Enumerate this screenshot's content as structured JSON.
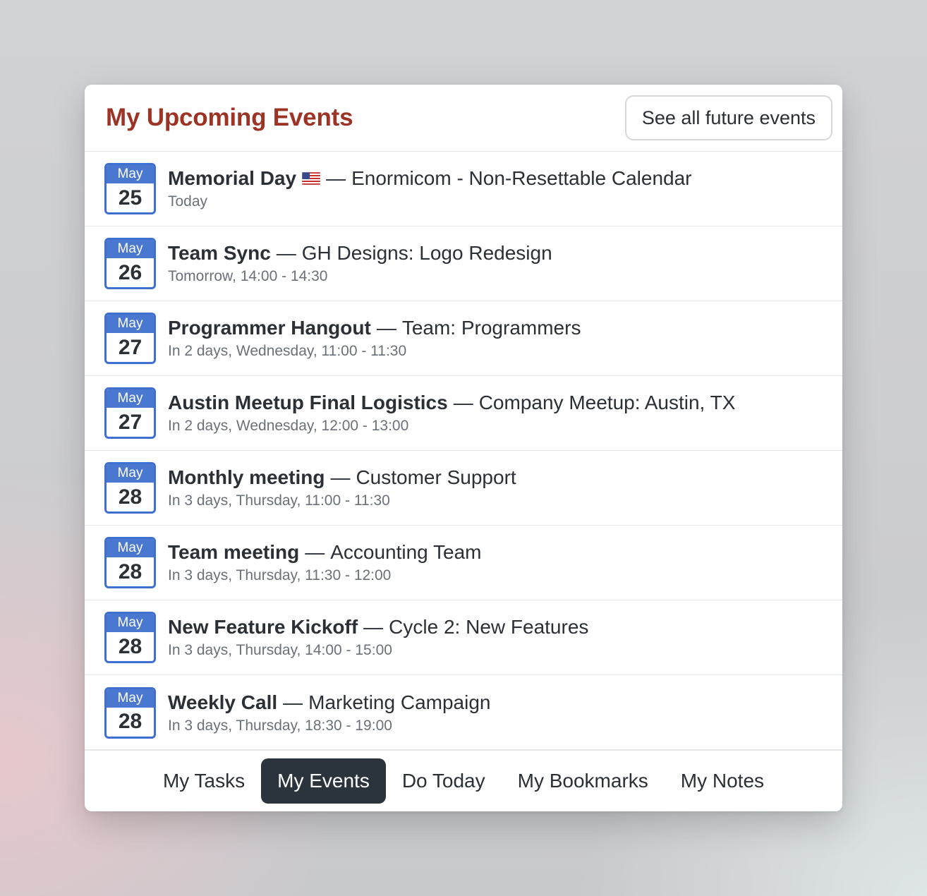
{
  "header": {
    "title": "My Upcoming Events",
    "see_all_label": "See all future events"
  },
  "events": [
    {
      "month": "May",
      "day": "25",
      "name": "Memorial Day",
      "separator": "—",
      "context": "Enormicom - Non-Resettable Calendar",
      "time": "Today",
      "icon": "us-flag-icon"
    },
    {
      "month": "May",
      "day": "26",
      "name": "Team Sync",
      "separator": "—",
      "context": "GH Designs: Logo Redesign",
      "time": "Tomorrow, 14:00 - 14:30"
    },
    {
      "month": "May",
      "day": "27",
      "name": "Programmer Hangout",
      "separator": "—",
      "context": "Team: Programmers",
      "time": "In 2 days, Wednesday, 11:00 - 11:30"
    },
    {
      "month": "May",
      "day": "27",
      "name": "Austin Meetup Final Logistics",
      "separator": "—",
      "context": "Company Meetup: Austin, TX",
      "time": "In 2 days, Wednesday, 12:00 - 13:00"
    },
    {
      "month": "May",
      "day": "28",
      "name": "Monthly meeting",
      "separator": "—",
      "context": "Customer Support",
      "time": "In 3 days, Thursday, 11:00 - 11:30"
    },
    {
      "month": "May",
      "day": "28",
      "name": "Team meeting",
      "separator": "—",
      "context": "Accounting Team",
      "time": "In 3 days, Thursday, 11:30 - 12:00"
    },
    {
      "month": "May",
      "day": "28",
      "name": "New Feature Kickoff",
      "separator": "—",
      "context": "Cycle 2: New Features",
      "time": "In 3 days, Thursday, 14:00 - 15:00"
    },
    {
      "month": "May",
      "day": "28",
      "name": "Weekly Call",
      "separator": "—",
      "context": "Marketing Campaign",
      "time": "In 3 days, Thursday, 18:30 - 19:00"
    }
  ],
  "tabs": [
    {
      "label": "My Tasks",
      "active": false
    },
    {
      "label": "My Events",
      "active": true
    },
    {
      "label": "Do Today",
      "active": false
    },
    {
      "label": "My Bookmarks",
      "active": false
    },
    {
      "label": "My Notes",
      "active": false
    }
  ],
  "colors": {
    "title": "#9c3325",
    "calendar_accent": "#4a78d1",
    "active_tab_bg": "#2b333c"
  }
}
